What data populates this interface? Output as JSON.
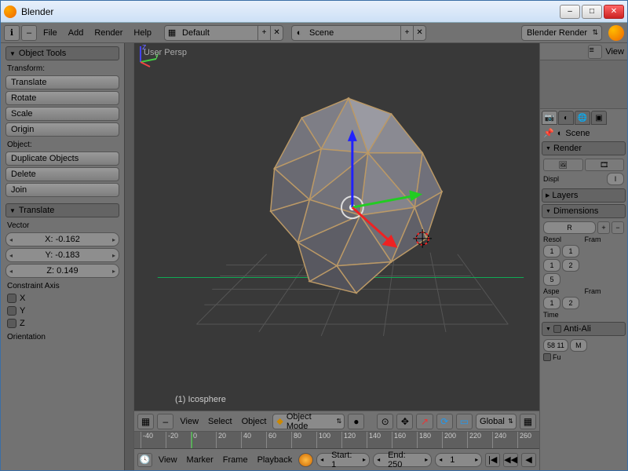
{
  "window": {
    "title": "Blender"
  },
  "menubar": {
    "items": [
      "File",
      "Add",
      "Render",
      "Help"
    ],
    "layout": {
      "value": "Default"
    },
    "scene": {
      "value": "Scene"
    },
    "engine": {
      "value": "Blender Render"
    }
  },
  "toolshelf": {
    "panel_tools": "Object Tools",
    "transform_label": "Transform:",
    "translate": "Translate",
    "rotate": "Rotate",
    "scale": "Scale",
    "origin": "Origin",
    "object_label": "Object:",
    "duplicate": "Duplicate Objects",
    "delete": "Delete",
    "join": "Join",
    "panel_translate": "Translate",
    "vector_label": "Vector",
    "x": "X: -0.162",
    "y": "Y: -0.183",
    "z": "Z: 0.149",
    "constraint_label": "Constraint Axis",
    "cx": "X",
    "cy": "Y",
    "cz": "Z",
    "orientation_label": "Orientation"
  },
  "viewport": {
    "persp": "User Persp",
    "object_name": "(1) Icosphere"
  },
  "vp_header": {
    "view": "View",
    "select": "Select",
    "object": "Object",
    "mode": "Object Mode",
    "orient": "Global"
  },
  "timeline": {
    "ticks": [
      "-40",
      "-20",
      "0",
      "20",
      "40",
      "60",
      "80",
      "100",
      "120",
      "140",
      "160",
      "180",
      "200",
      "220",
      "240",
      "260"
    ],
    "view": "View",
    "marker": "Marker",
    "frame": "Frame",
    "playback": "Playback",
    "start": "Start: 1",
    "end": "End: 250",
    "current": "1"
  },
  "outliner": {
    "view": "View"
  },
  "props": {
    "scene_crumb": "Scene",
    "render": "Render",
    "displ": "Displ",
    "displ_val": "I",
    "layers": "Layers",
    "dimensions": "Dimensions",
    "preset": "R",
    "resol": "Resol",
    "fram": "Fram",
    "r1": "1",
    "r2": "1",
    "r3": "5",
    "f1": "1",
    "f2": "2",
    "aspe": "Aspe",
    "fram2": "Fram",
    "a1": "1",
    "fr": "2",
    "time": "Time",
    "antialias": "Anti-Ali",
    "aa_val": "58 11",
    "aa_m": "M",
    "fu": "Fu"
  }
}
